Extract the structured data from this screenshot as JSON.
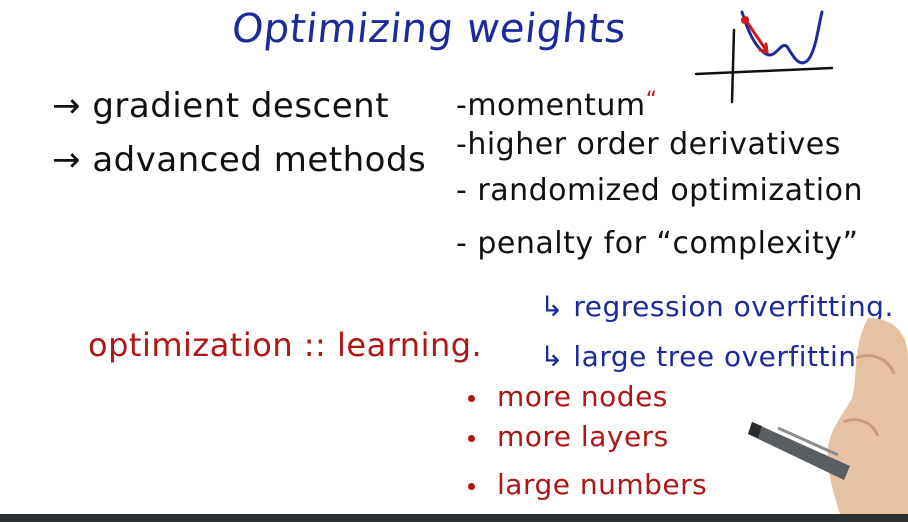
{
  "title": "Optimizing weights",
  "left_list": {
    "items": [
      "gradient descent",
      "advanced methods"
    ],
    "arrow_glyph": "→"
  },
  "advanced_list": {
    "items": [
      "-momentum",
      "-higher order derivatives",
      "- randomized optimization",
      "- penalty for “complexity”"
    ]
  },
  "complexity_sub": {
    "arrow_glyph": "↳",
    "items": [
      "regression overfitting.",
      "large tree overfitting"
    ]
  },
  "analogy": "optimization :: learning.",
  "complexity_causes": {
    "items": [
      "more nodes",
      "more layers",
      "large numbers"
    ]
  },
  "colors": {
    "blue_ink": "#1d2a9c",
    "black_ink": "#111111",
    "red_ink": "#b01616",
    "bottom_bar": "#2c3134"
  },
  "icons": {
    "loss_curve": "loss-curve-sketch-icon",
    "hand_with_pen": "hand-with-marker-icon"
  }
}
